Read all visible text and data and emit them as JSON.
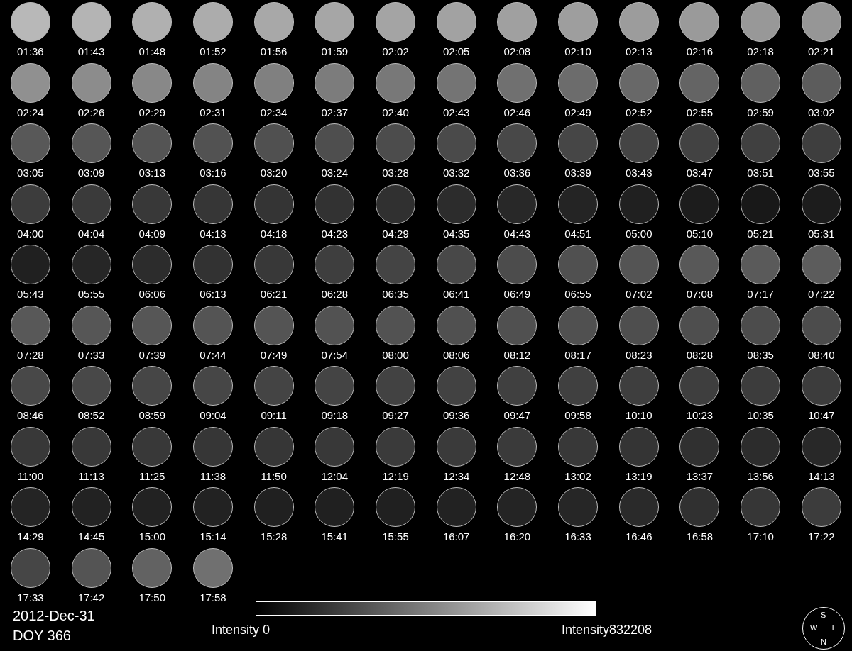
{
  "frames": [
    {
      "time": "01:36",
      "color": "#b8b8b8"
    },
    {
      "time": "01:43",
      "color": "#b4b4b4"
    },
    {
      "time": "01:48",
      "color": "#b0b0b0"
    },
    {
      "time": "01:52",
      "color": "#acacac"
    },
    {
      "time": "01:56",
      "color": "#a8a8a8"
    },
    {
      "time": "01:59",
      "color": "#a6a6a6"
    },
    {
      "time": "02:02",
      "color": "#a4a4a4"
    },
    {
      "time": "02:05",
      "color": "#a2a2a2"
    },
    {
      "time": "02:08",
      "color": "#a0a0a0"
    },
    {
      "time": "02:10",
      "color": "#9e9e9e"
    },
    {
      "time": "02:13",
      "color": "#9c9c9c"
    },
    {
      "time": "02:16",
      "color": "#9a9a9a"
    },
    {
      "time": "02:18",
      "color": "#989898"
    },
    {
      "time": "02:21",
      "color": "#969696"
    },
    {
      "time": "02:24",
      "color": "#909090"
    },
    {
      "time": "02:26",
      "color": "#8c8c8c"
    },
    {
      "time": "02:29",
      "color": "#888888"
    },
    {
      "time": "02:31",
      "color": "#848484"
    },
    {
      "time": "02:34",
      "color": "#808080"
    },
    {
      "time": "02:37",
      "color": "#7c7c7c"
    },
    {
      "time": "02:40",
      "color": "#787878"
    },
    {
      "time": "02:43",
      "color": "#747474"
    },
    {
      "time": "02:46",
      "color": "#707070"
    },
    {
      "time": "02:49",
      "color": "#6c6c6c"
    },
    {
      "time": "02:52",
      "color": "#686868"
    },
    {
      "time": "02:55",
      "color": "#646464"
    },
    {
      "time": "02:59",
      "color": "#606060"
    },
    {
      "time": "03:02",
      "color": "#5c5c5c"
    },
    {
      "time": "03:05",
      "color": "#585858"
    },
    {
      "time": "03:09",
      "color": "#565656"
    },
    {
      "time": "03:13",
      "color": "#545454"
    },
    {
      "time": "03:16",
      "color": "#525252"
    },
    {
      "time": "03:20",
      "color": "#505050"
    },
    {
      "time": "03:24",
      "color": "#4e4e4e"
    },
    {
      "time": "03:28",
      "color": "#4c4c4c"
    },
    {
      "time": "03:32",
      "color": "#4a4a4a"
    },
    {
      "time": "03:36",
      "color": "#484848"
    },
    {
      "time": "03:39",
      "color": "#464646"
    },
    {
      "time": "03:43",
      "color": "#444444"
    },
    {
      "time": "03:47",
      "color": "#424242"
    },
    {
      "time": "03:51",
      "color": "#404040"
    },
    {
      "time": "03:55",
      "color": "#3e3e3e"
    },
    {
      "time": "04:00",
      "color": "#3c3c3c"
    },
    {
      "time": "04:04",
      "color": "#3a3a3a"
    },
    {
      "time": "04:09",
      "color": "#383838"
    },
    {
      "time": "04:13",
      "color": "#363636"
    },
    {
      "time": "04:18",
      "color": "#343434"
    },
    {
      "time": "04:23",
      "color": "#323232"
    },
    {
      "time": "04:29",
      "color": "#303030"
    },
    {
      "time": "04:35",
      "color": "#2c2c2c"
    },
    {
      "time": "04:43",
      "color": "#282828"
    },
    {
      "time": "04:51",
      "color": "#242424"
    },
    {
      "time": "05:00",
      "color": "#202020"
    },
    {
      "time": "05:10",
      "color": "#1c1c1c"
    },
    {
      "time": "05:21",
      "color": "#181818"
    },
    {
      "time": "05:31",
      "color": "#1c1c1c"
    },
    {
      "time": "05:43",
      "color": "#202020"
    },
    {
      "time": "05:55",
      "color": "#262626"
    },
    {
      "time": "06:06",
      "color": "#2c2c2c"
    },
    {
      "time": "06:13",
      "color": "#323232"
    },
    {
      "time": "06:21",
      "color": "#383838"
    },
    {
      "time": "06:28",
      "color": "#3e3e3e"
    },
    {
      "time": "06:35",
      "color": "#444444"
    },
    {
      "time": "06:41",
      "color": "#484848"
    },
    {
      "time": "06:49",
      "color": "#4c4c4c"
    },
    {
      "time": "06:55",
      "color": "#505050"
    },
    {
      "time": "07:02",
      "color": "#545454"
    },
    {
      "time": "07:08",
      "color": "#585858"
    },
    {
      "time": "07:17",
      "color": "#5a5a5a"
    },
    {
      "time": "07:22",
      "color": "#5c5c5c"
    },
    {
      "time": "07:28",
      "color": "#585858"
    },
    {
      "time": "07:33",
      "color": "#565656"
    },
    {
      "time": "07:39",
      "color": "#565656"
    },
    {
      "time": "07:44",
      "color": "#545454"
    },
    {
      "time": "07:49",
      "color": "#545454"
    },
    {
      "time": "07:54",
      "color": "#525252"
    },
    {
      "time": "08:00",
      "color": "#525252"
    },
    {
      "time": "08:06",
      "color": "#505050"
    },
    {
      "time": "08:12",
      "color": "#505050"
    },
    {
      "time": "08:17",
      "color": "#505050"
    },
    {
      "time": "08:23",
      "color": "#4e4e4e"
    },
    {
      "time": "08:28",
      "color": "#4e4e4e"
    },
    {
      "time": "08:35",
      "color": "#4c4c4c"
    },
    {
      "time": "08:40",
      "color": "#4c4c4c"
    },
    {
      "time": "08:46",
      "color": "#484848"
    },
    {
      "time": "08:52",
      "color": "#484848"
    },
    {
      "time": "08:59",
      "color": "#464646"
    },
    {
      "time": "09:04",
      "color": "#464646"
    },
    {
      "time": "09:11",
      "color": "#444444"
    },
    {
      "time": "09:18",
      "color": "#444444"
    },
    {
      "time": "09:27",
      "color": "#424242"
    },
    {
      "time": "09:36",
      "color": "#424242"
    },
    {
      "time": "09:47",
      "color": "#404040"
    },
    {
      "time": "09:58",
      "color": "#404040"
    },
    {
      "time": "10:10",
      "color": "#3e3e3e"
    },
    {
      "time": "10:23",
      "color": "#3e3e3e"
    },
    {
      "time": "10:35",
      "color": "#3c3c3c"
    },
    {
      "time": "10:47",
      "color": "#3c3c3c"
    },
    {
      "time": "11:00",
      "color": "#383838"
    },
    {
      "time": "11:13",
      "color": "#383838"
    },
    {
      "time": "11:25",
      "color": "#383838"
    },
    {
      "time": "11:38",
      "color": "#363636"
    },
    {
      "time": "11:50",
      "color": "#363636"
    },
    {
      "time": "12:04",
      "color": "#383838"
    },
    {
      "time": "12:19",
      "color": "#3a3a3a"
    },
    {
      "time": "12:34",
      "color": "#3a3a3a"
    },
    {
      "time": "12:48",
      "color": "#3a3a3a"
    },
    {
      "time": "13:02",
      "color": "#383838"
    },
    {
      "time": "13:19",
      "color": "#343434"
    },
    {
      "time": "13:37",
      "color": "#303030"
    },
    {
      "time": "13:56",
      "color": "#2c2c2c"
    },
    {
      "time": "14:13",
      "color": "#282828"
    },
    {
      "time": "14:29",
      "color": "#242424"
    },
    {
      "time": "14:45",
      "color": "#222222"
    },
    {
      "time": "15:00",
      "color": "#222222"
    },
    {
      "time": "15:14",
      "color": "#222222"
    },
    {
      "time": "15:28",
      "color": "#202020"
    },
    {
      "time": "15:41",
      "color": "#202020"
    },
    {
      "time": "15:55",
      "color": "#202020"
    },
    {
      "time": "16:07",
      "color": "#222222"
    },
    {
      "time": "16:20",
      "color": "#242424"
    },
    {
      "time": "16:33",
      "color": "#262626"
    },
    {
      "time": "16:46",
      "color": "#2a2a2a"
    },
    {
      "time": "16:58",
      "color": "#303030"
    },
    {
      "time": "17:10",
      "color": "#363636"
    },
    {
      "time": "17:22",
      "color": "#3c3c3c"
    },
    {
      "time": "17:33",
      "color": "#464646"
    },
    {
      "time": "17:42",
      "color": "#545454"
    },
    {
      "time": "17:50",
      "color": "#626262"
    },
    {
      "time": "17:58",
      "color": "#707070"
    }
  ],
  "date": "2012-Dec-31",
  "doy": "DOY 366",
  "colorbar": {
    "min_label": "Intensity 0",
    "max_label": "Intensity832208"
  },
  "compass": {
    "top": "S",
    "left": "W",
    "right": "E",
    "bottom": "N"
  }
}
